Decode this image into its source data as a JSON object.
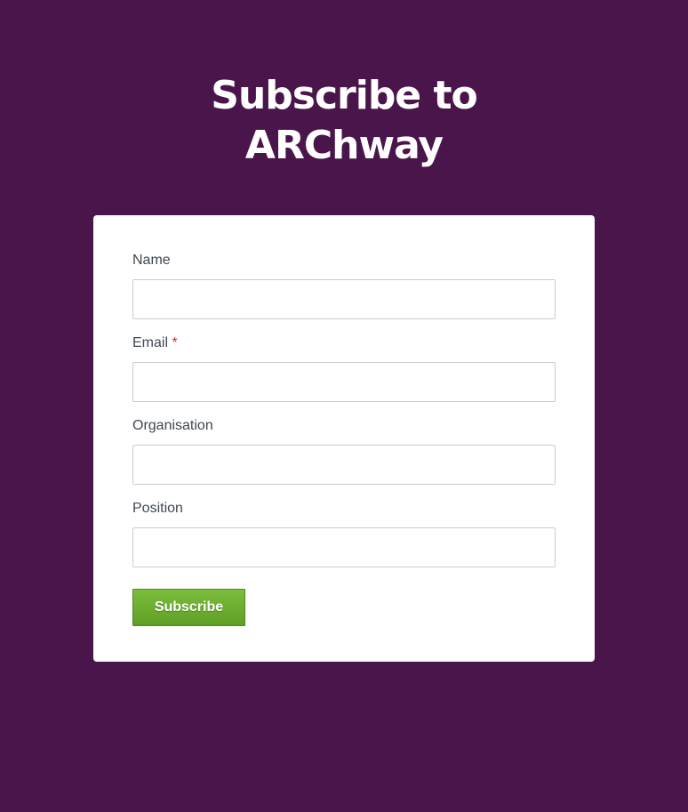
{
  "page": {
    "title_line1": "Subscribe to",
    "title_line2": "ARChway"
  },
  "form": {
    "fields": [
      {
        "label": "Name",
        "required": false,
        "value": ""
      },
      {
        "label": "Email",
        "required": true,
        "required_marker": "*",
        "value": ""
      },
      {
        "label": "Organisation",
        "required": false,
        "value": ""
      },
      {
        "label": "Position",
        "required": false,
        "value": ""
      }
    ],
    "submit_label": "Subscribe"
  },
  "colors": {
    "background": "#4a154b",
    "card": "#ffffff",
    "button": "#6aaa2f",
    "required": "#e02020"
  }
}
